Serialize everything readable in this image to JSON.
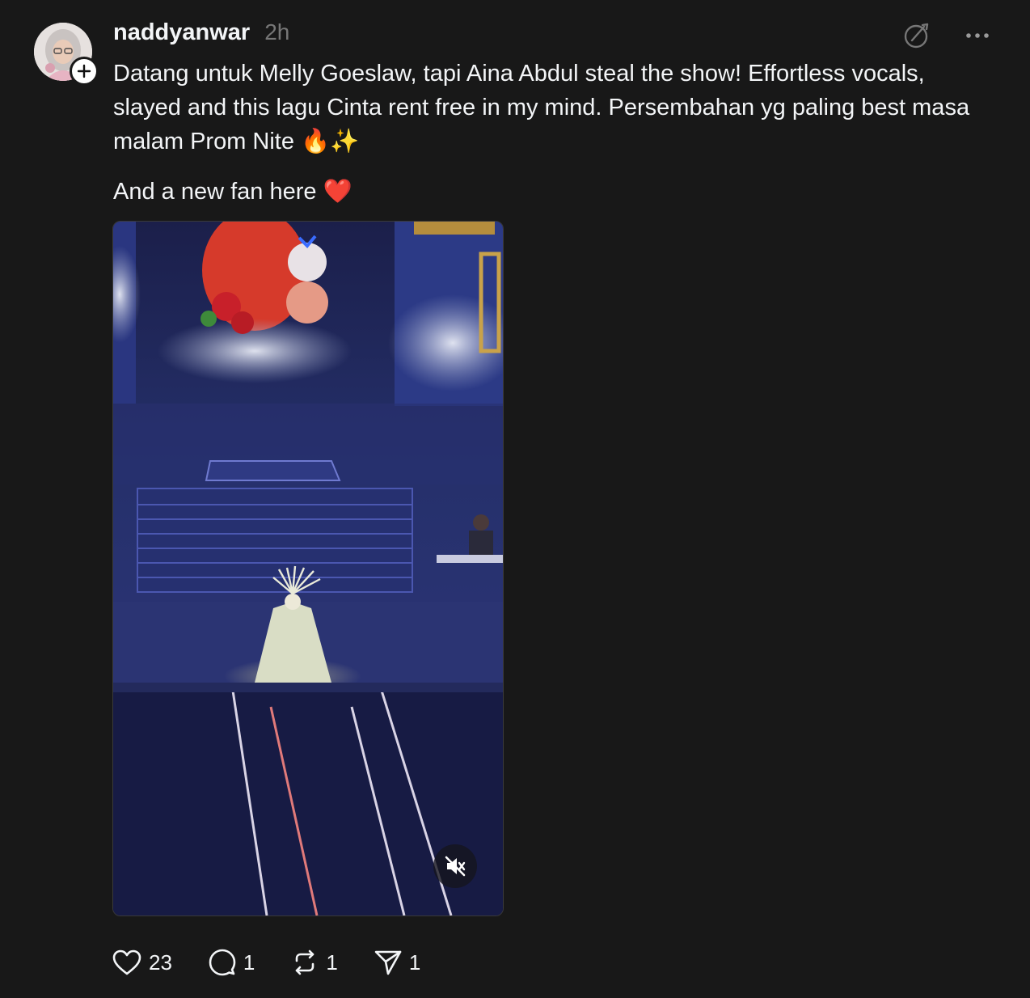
{
  "post": {
    "username": "naddyanwar",
    "timestamp": "2h",
    "caption_line1": "Datang untuk Melly Goeslaw, tapi Aina Abdul steal the show! Effortless vocals, slayed and this lagu Cinta rent free in my mind. Persembahan yg paling best masa malam Prom Nite 🔥✨",
    "caption_line2": "And a new fan here ❤️"
  },
  "media": {
    "type": "video",
    "muted": true
  },
  "stats": {
    "likes": "23",
    "replies": "1",
    "reposts": "1",
    "shares": "1"
  },
  "icons": {
    "top_right": [
      "no-edit-icon",
      "more-icon"
    ],
    "avatar_badge": "plus-icon",
    "media": "muted-speaker-icon",
    "actions": [
      "heart-icon",
      "comment-icon",
      "repost-icon",
      "send-icon"
    ]
  },
  "colors": {
    "background": "#181818",
    "text_primary": "#f3f5f7",
    "text_secondary": "#777777"
  }
}
